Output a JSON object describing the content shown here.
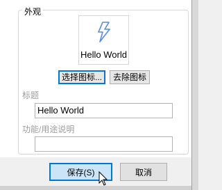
{
  "section": {
    "title": "外观"
  },
  "preview": {
    "icon": "lightning-icon",
    "label": "Hello World"
  },
  "icon_buttons": {
    "choose": "选择图标...",
    "remove": "去除图标"
  },
  "title_field": {
    "label": "标题",
    "value": "Hello World"
  },
  "desc_field": {
    "label": "功能/用途说明",
    "value": ""
  },
  "footer": {
    "save": "保存(S)",
    "cancel": "取消"
  },
  "colors": {
    "accent": "#0078d7",
    "primary_bg": "#cce4f7",
    "icon_blue": "#5a8ed6"
  }
}
